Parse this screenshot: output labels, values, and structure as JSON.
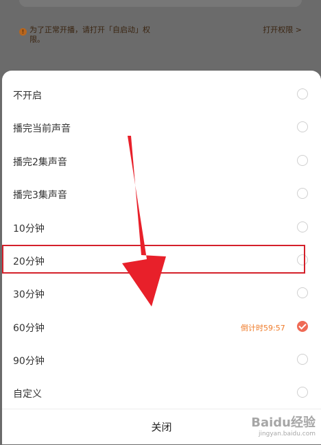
{
  "notice": {
    "text": "为了正常开播，请打开「自启动」权限。",
    "link": "打开权限 >",
    "icon": "info-icon"
  },
  "options": [
    {
      "label": "不开启",
      "checked": false
    },
    {
      "label": "播完当前声音",
      "checked": false
    },
    {
      "label": "播完2集声音",
      "checked": false
    },
    {
      "label": "播完3集声音",
      "checked": false
    },
    {
      "label": "10分钟",
      "checked": false
    },
    {
      "label": "20分钟",
      "checked": false
    },
    {
      "label": "30分钟",
      "checked": false
    },
    {
      "label": "60分钟",
      "checked": true,
      "countdown": "倒计时59:57"
    },
    {
      "label": "90分钟",
      "checked": false
    },
    {
      "label": "自定义",
      "checked": false
    }
  ],
  "close_label": "关闭",
  "colors": {
    "accent": "#ef6a55",
    "countdown": "#ef7a28",
    "highlight": "#d4202a",
    "arrow": "#e8202a"
  },
  "watermark": {
    "main": "Baidu经验",
    "sub": "jingyan.baidu.com"
  }
}
